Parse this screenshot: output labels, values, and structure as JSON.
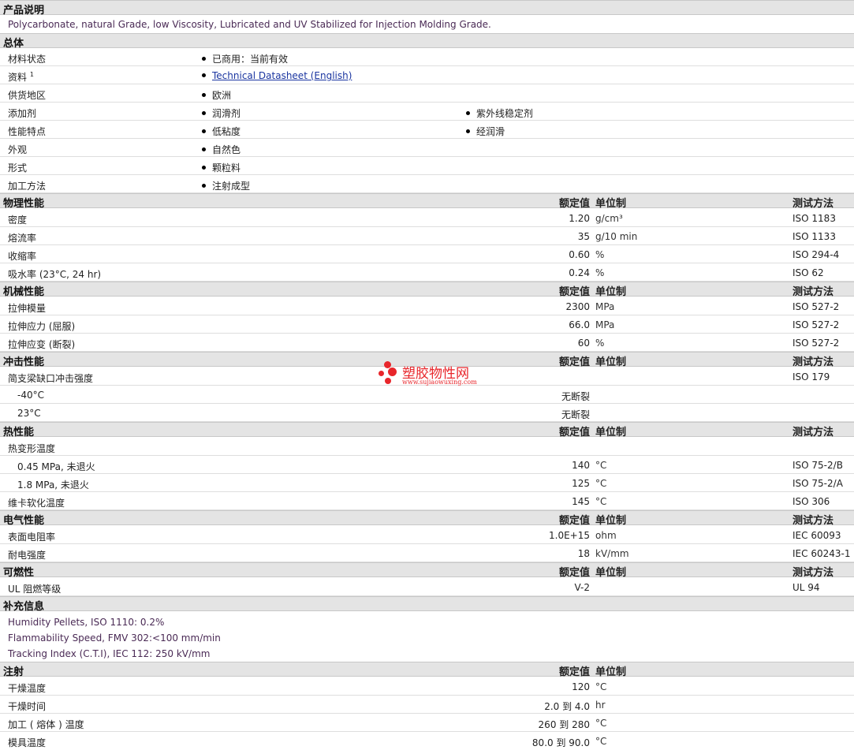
{
  "description": {
    "title": "产品说明",
    "text": "Polycarbonate, natural Grade, low Viscosity, Lubricated and UV Stabilized for Injection Molding Grade."
  },
  "general": {
    "title": "总体",
    "rows": [
      {
        "label": "材料状态",
        "items": [
          "已商用：当前有效"
        ]
      },
      {
        "label": "资料",
        "sup": "1",
        "items": [
          "Technical Datasheet (English)"
        ]
      },
      {
        "label": "供货地区",
        "items": [
          "欧洲"
        ]
      },
      {
        "label": "添加剂",
        "items": [
          "润滑剂",
          "紫外线稳定剂"
        ]
      },
      {
        "label": "性能特点",
        "items": [
          "低粘度",
          "经润滑"
        ]
      },
      {
        "label": "外观",
        "items": [
          "自然色"
        ]
      },
      {
        "label": "形式",
        "items": [
          "颗粒料"
        ]
      },
      {
        "label": "加工方法",
        "items": [
          "注射成型"
        ]
      }
    ]
  },
  "headers": {
    "value": "额定值",
    "unit": "单位制",
    "method": "测试方法"
  },
  "physical": {
    "title": "物理性能",
    "rows": [
      {
        "label": "密度",
        "value": "1.20",
        "unit": "g/cm³",
        "method": "ISO 1183"
      },
      {
        "label": "熔流率",
        "value": "35",
        "unit": "g/10 min",
        "method": "ISO 1133"
      },
      {
        "label": "收缩率",
        "value": "0.60",
        "unit": "%",
        "method": "ISO 294-4"
      },
      {
        "label": "吸水率 (23°C, 24 hr)",
        "value": "0.24",
        "unit": "%",
        "method": "ISO 62"
      }
    ]
  },
  "mechanical": {
    "title": "机械性能",
    "rows": [
      {
        "label": "拉伸模量",
        "value": "2300",
        "unit": "MPa",
        "method": "ISO 527-2"
      },
      {
        "label": "拉伸应力 (屈服)",
        "value": "66.0",
        "unit": "MPa",
        "method": "ISO 527-2"
      },
      {
        "label": "拉伸应变 (断裂)",
        "value": "60",
        "unit": "%",
        "method": "ISO 527-2"
      }
    ]
  },
  "impact": {
    "title": "冲击性能",
    "rows": [
      {
        "label": "简支梁缺口冲击强度",
        "value": "",
        "unit": "",
        "method": "ISO 179"
      },
      {
        "label": "-40°C",
        "value": "无断裂",
        "unit": "",
        "method": ""
      },
      {
        "label": "23°C",
        "value": "无断裂",
        "unit": "",
        "method": ""
      }
    ]
  },
  "thermal": {
    "title": "热性能",
    "rows": [
      {
        "label": "热变形温度",
        "value": "",
        "unit": "",
        "method": ""
      },
      {
        "label": "0.45 MPa, 未退火",
        "value": "140",
        "unit": "°C",
        "method": "ISO 75-2/B"
      },
      {
        "label": "1.8 MPa, 未退火",
        "value": "125",
        "unit": "°C",
        "method": "ISO 75-2/A"
      },
      {
        "label": "维卡软化温度",
        "value": "145",
        "unit": "°C",
        "method": "ISO 306"
      }
    ]
  },
  "electrical": {
    "title": "电气性能",
    "rows": [
      {
        "label": "表面电阻率",
        "value": "1.0E+15",
        "unit": "ohm",
        "method": "IEC 60093"
      },
      {
        "label": "耐电强度",
        "value": "18",
        "unit": "kV/mm",
        "method": "IEC 60243-1"
      }
    ]
  },
  "flammability": {
    "title": "可燃性",
    "rows": [
      {
        "label": "UL 阻燃等级",
        "value": "V-2",
        "unit": "",
        "method": "UL 94"
      }
    ]
  },
  "supplement": {
    "title": "补充信息",
    "notes": [
      "Humidity Pellets, ISO 1110: 0.2%",
      "Flammability Speed, FMV 302:<100 mm/min",
      "Tracking Index (C.T.I), IEC 112: 250 kV/mm"
    ]
  },
  "injection": {
    "title": "注射",
    "rows": [
      {
        "label": "干燥温度",
        "value": "120",
        "unit": "°C"
      },
      {
        "label": "干燥时间",
        "value": "2.0 到  4.0",
        "unit": "hr"
      },
      {
        "label": "加工 ( 熔体 ) 温度",
        "value": "260 到  280",
        "unit": "°C"
      },
      {
        "label": "模具温度",
        "value": "80.0 到  90.0",
        "unit": "°C"
      }
    ]
  },
  "watermark": {
    "name": "塑胶物性网",
    "url": "www.sujiaowuxing.com",
    "color": "#e8262b"
  }
}
